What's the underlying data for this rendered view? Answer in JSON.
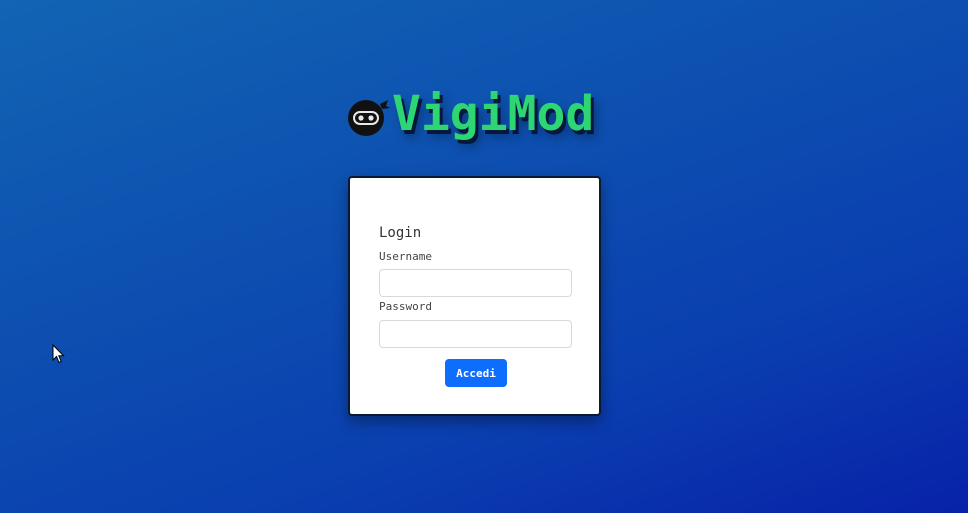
{
  "brand": {
    "name": "VigiMod",
    "logo_icon": "ninja-face-icon",
    "color": "#2ed573"
  },
  "login_card": {
    "title": "Login",
    "username_label": "Username",
    "username_value": "",
    "password_label": "Password",
    "password_value": "",
    "submit_label": "Accedi",
    "submit_color": "#0d6efd"
  },
  "background": {
    "gradient_start": "#1264b4",
    "gradient_end": "#0822a8"
  },
  "cursor": {
    "icon": "mouse-pointer-icon"
  }
}
